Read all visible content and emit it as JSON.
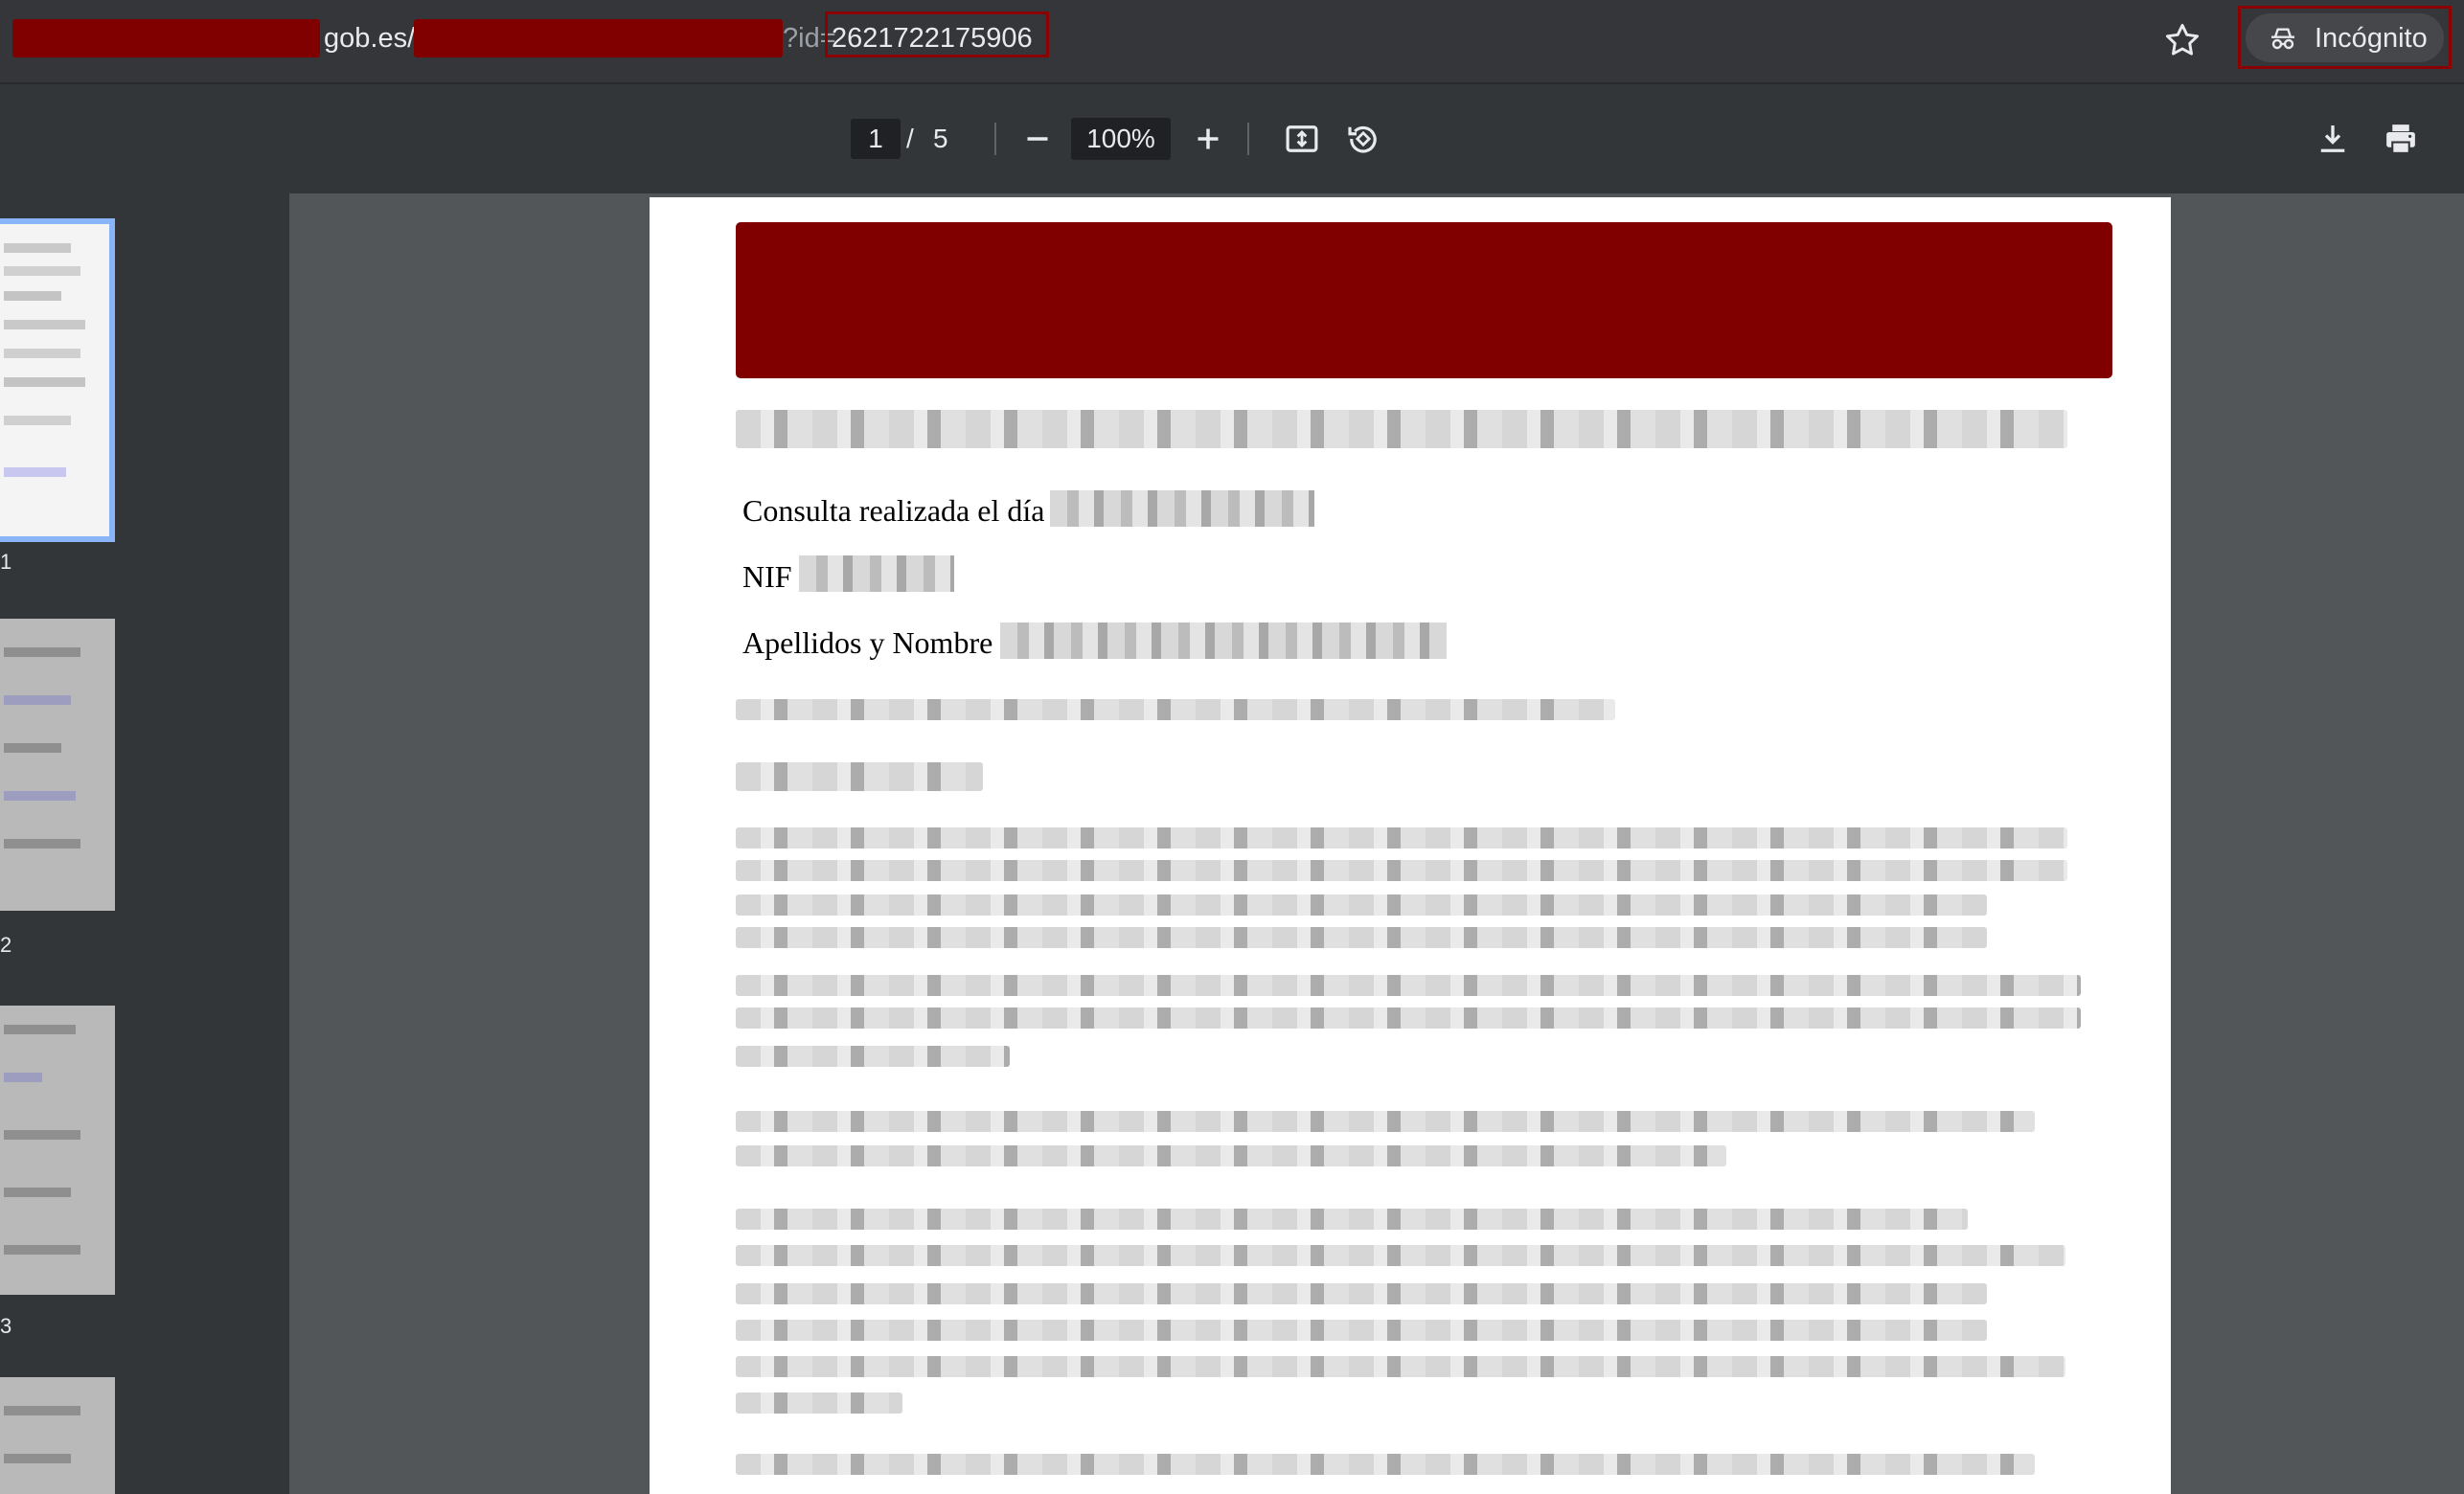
{
  "browser": {
    "url_domain": "gob.es/",
    "url_query": "?id=",
    "url_id": "2621722175906",
    "profile_label": "Incógnito"
  },
  "pdf_toolbar": {
    "current_page": "1",
    "page_separator": "/",
    "total_pages": "5",
    "zoom": "100%"
  },
  "sidebar": {
    "thumbnails": [
      "1",
      "2",
      "3"
    ]
  },
  "document": {
    "fields": {
      "consulta_label": "Consulta realizada el día",
      "nif_label": "NIF",
      "apellidos_label": "Apellidos y Nombre"
    }
  }
}
